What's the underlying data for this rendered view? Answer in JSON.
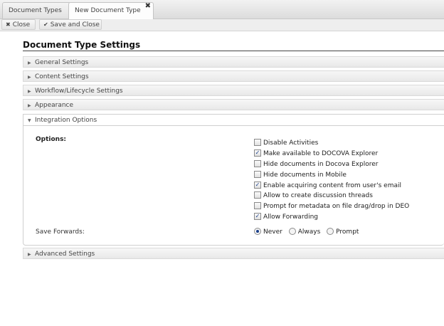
{
  "tabs": [
    {
      "label": "Document Types"
    },
    {
      "label": "New Document Type",
      "close_glyph": "✖"
    }
  ],
  "toolbar": {
    "close_label": "Close",
    "save_close_label": "Save and Close"
  },
  "page_title": "Document Type Settings",
  "sections": [
    {
      "label": "General Settings",
      "expanded": false
    },
    {
      "label": "Content Settings",
      "expanded": false
    },
    {
      "label": "Workflow/Lifecycle Settings",
      "expanded": false
    },
    {
      "label": "Appearance",
      "expanded": false
    },
    {
      "label": "Integration Options",
      "expanded": true
    },
    {
      "label": "Advanced Settings",
      "expanded": false
    }
  ],
  "integration": {
    "options_label": "Options:",
    "options": [
      {
        "label": "Disable Activities",
        "checked": false
      },
      {
        "label": "Make available to DOCOVA Explorer",
        "checked": true
      },
      {
        "label": "Hide documents in Docova Explorer",
        "checked": false
      },
      {
        "label": "Hide documents in Mobile",
        "checked": false
      },
      {
        "label": "Enable acquiring content from user's email",
        "checked": true
      },
      {
        "label": "Allow to create discussion threads",
        "checked": false
      },
      {
        "label": "Prompt for metadata on file drag/drop in DEO",
        "checked": false
      },
      {
        "label": "Allow Forwarding",
        "checked": true
      }
    ],
    "save_forwards_label": "Save Forwards:",
    "save_forwards_options": [
      "Never",
      "Always",
      "Prompt"
    ],
    "save_forwards_selected": "Never"
  },
  "colors": {
    "accent": "#1a3f8a"
  }
}
